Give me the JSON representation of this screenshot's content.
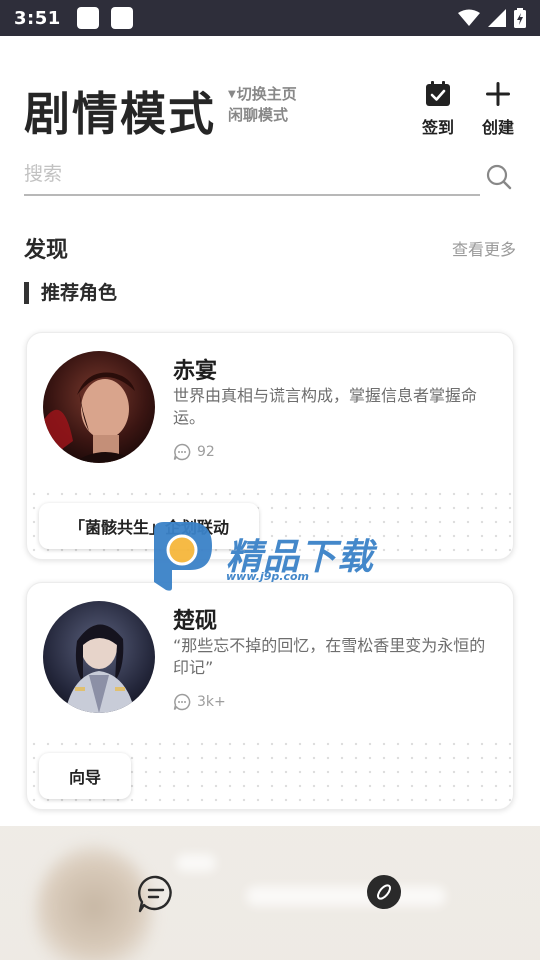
{
  "status_bar": {
    "time": "3:51"
  },
  "header": {
    "title": "剧情模式",
    "switch_line1": "切换主页",
    "switch_line2": "闲聊模式",
    "checkin_label": "签到",
    "create_label": "创建"
  },
  "search": {
    "placeholder": "搜索"
  },
  "discover": {
    "title": "发现",
    "more": "查看更多",
    "recommended_title": "推荐角色"
  },
  "cards": [
    {
      "name": "赤宴",
      "description": "世界由真相与谎言构成，掌握信息者掌握命运。",
      "count": "92",
      "tag": "「菌骸共生」企划联动"
    },
    {
      "name": "楚砚",
      "description": "“那些忘不掉的回忆，在雪松香里变为永恒的印记”",
      "count": "3k+",
      "tag": "向导"
    }
  ],
  "watermark": {
    "text": "精品下载",
    "url": "www.j9p.com"
  },
  "colors": {
    "status_bar": "#2e2e3a",
    "accent_watermark": "#3b82c8",
    "nav_bg": "#ece8e2"
  },
  "icons": [
    "calendar-check-icon",
    "plus-icon",
    "search-icon",
    "chat-bubble-icon",
    "compass-icon",
    "wifi-icon",
    "signal-icon",
    "battery-icon"
  ]
}
